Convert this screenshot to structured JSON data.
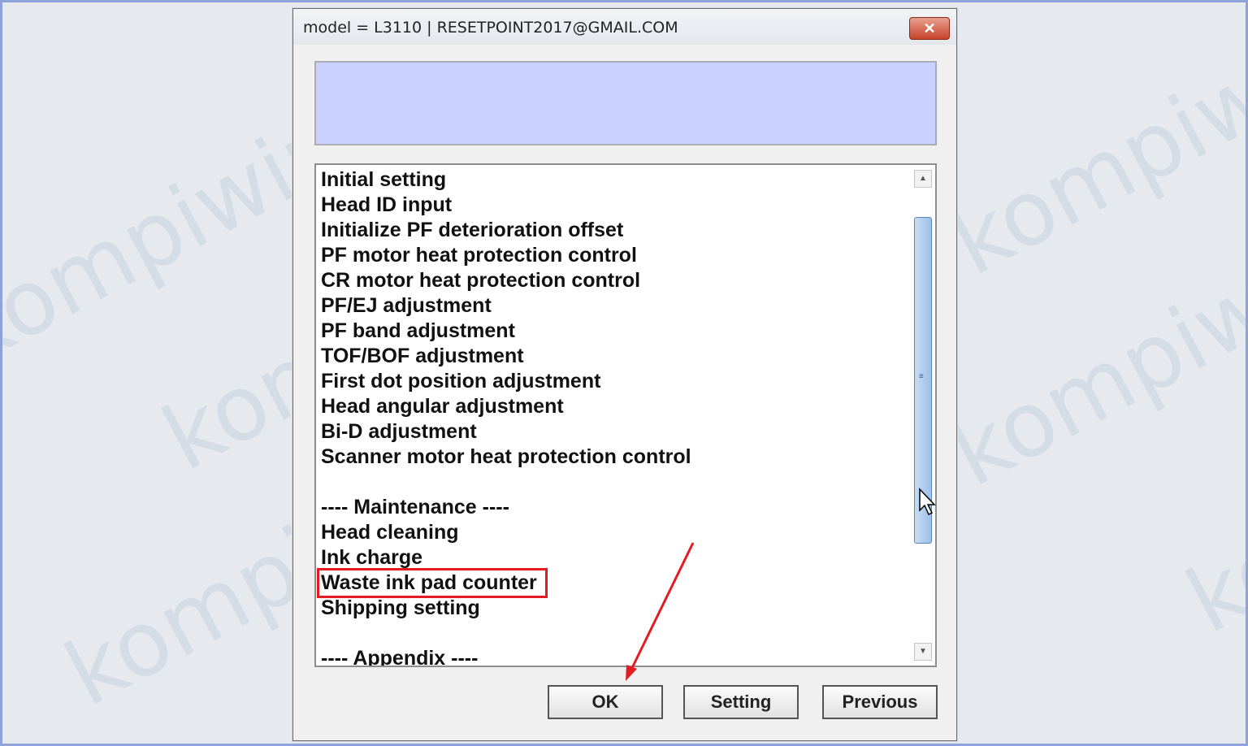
{
  "window": {
    "title": "model = L3110 | RESETPOINT2017@GMAIL.COM",
    "close_label": "✕"
  },
  "watermark_text": "kompiwin",
  "list": {
    "items": [
      "Initial setting",
      "Head ID input",
      "Initialize PF deterioration offset",
      "PF motor heat protection control",
      "CR motor heat protection control",
      "PF/EJ adjustment",
      "PF band adjustment",
      "TOF/BOF adjustment",
      "First dot position adjustment",
      "Head angular adjustment",
      "Bi-D adjustment",
      "Scanner motor heat protection control",
      "",
      "---- Maintenance ----",
      "Head cleaning",
      "Ink charge",
      "Waste ink pad counter",
      "Shipping setting",
      "",
      "---- Appendix ----"
    ],
    "highlighted_item": "Waste ink pad counter",
    "highlight_color": "#e51b23"
  },
  "buttons": {
    "ok": "OK",
    "setting": "Setting",
    "previous": "Previous"
  },
  "colors": {
    "status_panel": "#cad1ff",
    "annotation_arrow": "#e51b23"
  }
}
